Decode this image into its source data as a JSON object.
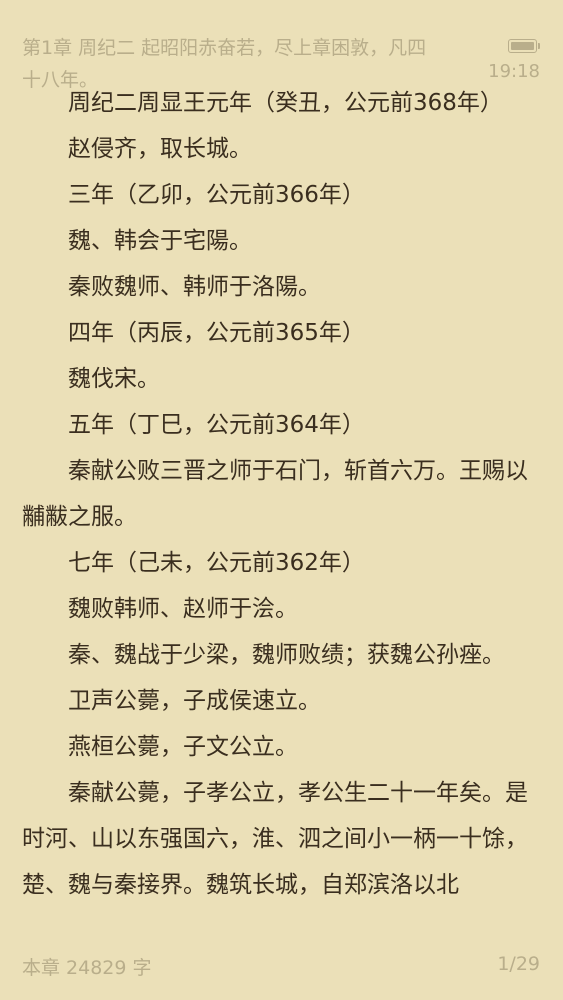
{
  "header": {
    "chapter_title": "第1章 周纪二 起昭阳赤奋若，尽上章困敦，凡四十八年。",
    "time": "19:18",
    "battery_icon": "battery-icon"
  },
  "paragraphs": [
    "周纪二周显王元年（癸丑，公元前368年）",
    "赵侵齐，取长城。",
    "三年（乙卯，公元前366年）",
    "魏、韩会于宅陽。",
    "秦败魏师、韩师于洛陽。",
    "四年（丙辰，公元前365年）",
    "魏伐宋。",
    "五年（丁巳，公元前364年）",
    "秦献公败三晋之师于石门，斩首六万。王赐以黼黻之服。",
    "七年（己未，公元前362年）",
    "魏败韩师、赵师于浍。",
    "秦、魏战于少梁，魏师败绩；获魏公孙痤。",
    "卫声公薨，子成侯速立。",
    "燕桓公薨，子文公立。",
    "秦献公薨，子孝公立，孝公生二十一年矣。是时河、山以东强国六，淮、泗之间小一柄一十馀，楚、魏与秦接界。魏筑长城，自郑滨洛以北"
  ],
  "footer": {
    "word_count": "本章 24829 字",
    "page": "1/29"
  }
}
